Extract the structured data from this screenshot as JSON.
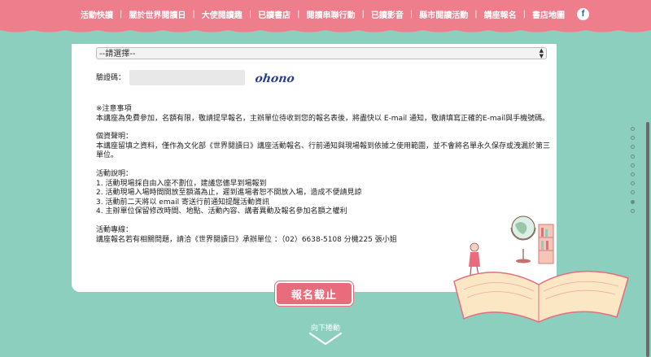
{
  "nav": {
    "items": [
      "活動快讀",
      "關於世界閱讀日",
      "大使閱讀趣",
      "已讀書店",
      "閱讀串聯行動",
      "已讀影音",
      "縣市閱讀活動",
      "講座報名",
      "書店地圖"
    ],
    "facebook_icon": "facebook-icon"
  },
  "form": {
    "select_value": "--請選擇--",
    "captcha_label": "驗證碼：",
    "captcha_value": "",
    "captcha_text": "ohono"
  },
  "notes": {
    "heading": "※注意事項",
    "body": "本講座為免費參加，名額有限，敬請提早報名，主辦單位待收到您的報名表後，將盡快以 E-mail 通知，敬請填寫正確的E-mail與手機號碼。",
    "privacy_title": "個資聲明：",
    "privacy_body": "本講座留填之資料，僅作為文化部《世界閱讀日》講座活動報名、行前通知與現場報到依據之使用範圍，並不會將名單永久保存或洩漏於第三單位。",
    "rules_title": "活動說明：",
    "rules": [
      "1. 活動現場採自由入座不劃位，建議您儘早到場報到",
      "2. 活動現場入場時間開放至額滿為止，遲到進場者恕不開放入場，造成不便請見諒",
      "3. 活動前二天將以 email 寄送行前通知提醒活動資訊",
      "4. 主辦單位保留修改時間、地點、活動內容、講者異動及報名參加名額之權利"
    ],
    "contact_title": "活動專線：",
    "contact_body": "講座報名若有相關問題，請洽《世界閱讀日》承辦單位 ：（02）6638-5108 分機225 張小姐"
  },
  "deadline_label": "報名截止",
  "scroll_hint": "向下捲動",
  "colors": {
    "background": "#8dcfbf",
    "nav": "#ef7e8c",
    "button": "#e86c7b"
  },
  "page_dots": {
    "count": 10,
    "active_index": 8
  }
}
